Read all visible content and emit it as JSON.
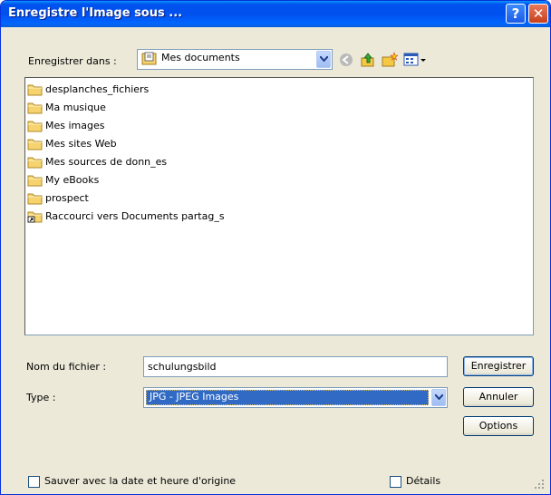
{
  "window": {
    "title": "Enregistre l'Image sous ...",
    "help_glyph": "?",
    "close_glyph": "✕"
  },
  "location": {
    "label": "Enregistrer dans :",
    "selected": "Mes documents"
  },
  "toolbar": {
    "icons": [
      "back-icon",
      "up-folder-icon",
      "new-folder-icon",
      "view-menu-icon"
    ]
  },
  "files": [
    {
      "name": "desplanches_fichiers",
      "icon": "folder-icon"
    },
    {
      "name": "Ma musique",
      "icon": "folder-icon"
    },
    {
      "name": "Mes images",
      "icon": "folder-icon"
    },
    {
      "name": "Mes sites Web",
      "icon": "folder-icon"
    },
    {
      "name": "Mes sources de donn_es",
      "icon": "folder-icon"
    },
    {
      "name": "My eBooks",
      "icon": "folder-icon"
    },
    {
      "name": "prospect",
      "icon": "folder-icon"
    },
    {
      "name": "Raccourci vers Documents partag_s",
      "icon": "folder-shortcut-icon"
    }
  ],
  "filename": {
    "label": "Nom du fichier :",
    "value": "schulungsbild"
  },
  "type": {
    "label": "Type :",
    "selected": "JPG - JPEG Images"
  },
  "buttons": {
    "save": "Enregistrer",
    "cancel": "Annuler",
    "options": "Options"
  },
  "options": {
    "keep_date": "Sauver avec la date et heure d'origine",
    "details": "Détails"
  },
  "colors": {
    "titlebar": "#0054e3",
    "selection": "#316ac5",
    "dialog_bg": "#ece9d8"
  }
}
